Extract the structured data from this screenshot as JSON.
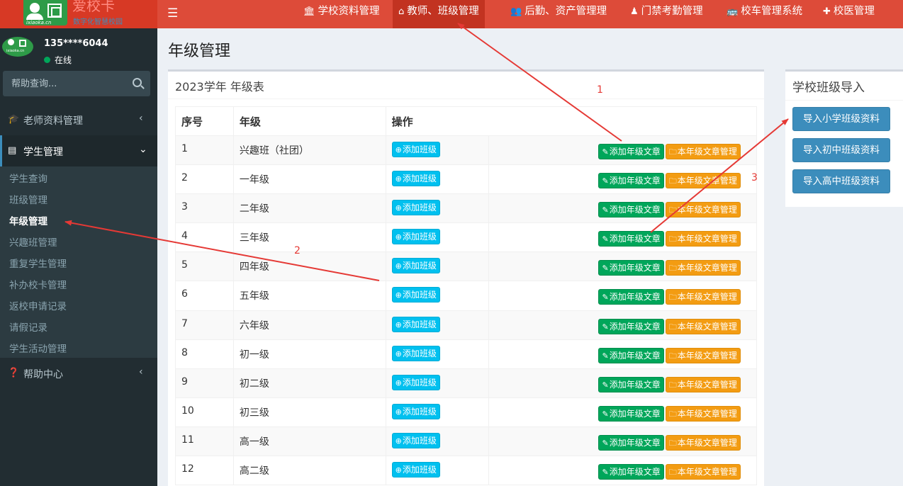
{
  "brand": {
    "logo_url_text": "ixiaoka.cn",
    "name": "爱校卡",
    "slogan": "数字化智慧校园"
  },
  "topnav": {
    "items": [
      {
        "icon": "bank-icon",
        "label": "学校资料管理"
      },
      {
        "icon": "home-icon",
        "label": "教师、班级管理"
      },
      {
        "icon": "users-icon",
        "label": "后勤、资产管理理"
      },
      {
        "icon": "person-icon",
        "label": "门禁考勤管理"
      },
      {
        "icon": "bus-icon",
        "label": "校车管理系统"
      },
      {
        "icon": "plus-icon",
        "label": "校医管理"
      }
    ]
  },
  "user": {
    "name": "135****6044",
    "status": "在线"
  },
  "search": {
    "placeholder": "帮助查询..."
  },
  "sidebar": {
    "menus": [
      {
        "icon": "graduation-cap-icon",
        "label": "老师资料管理"
      },
      {
        "icon": "id-card-icon",
        "label": "学生管理"
      },
      {
        "icon": "question-circle-icon",
        "label": "帮助中心"
      }
    ],
    "submenu": [
      "学生查询",
      "班级管理",
      "年级管理",
      "兴趣班管理",
      "重复学生管理",
      "补办校卡管理",
      "返校申请记录",
      "请假记录",
      "学生活动管理"
    ]
  },
  "page": {
    "title": "年级管理"
  },
  "grade_box": {
    "title": "2023学年 年级表",
    "headers": [
      "序号",
      "年级",
      "操作"
    ],
    "add_class_label": "添加班级",
    "add_article_label": "添加年级文章",
    "manage_article_label": "本年级文章管理",
    "rows": [
      {
        "no": "1",
        "grade": "兴趣班（社团）"
      },
      {
        "no": "2",
        "grade": "一年级"
      },
      {
        "no": "3",
        "grade": "二年级"
      },
      {
        "no": "4",
        "grade": "三年级"
      },
      {
        "no": "5",
        "grade": "四年级"
      },
      {
        "no": "6",
        "grade": "五年级"
      },
      {
        "no": "7",
        "grade": "六年级"
      },
      {
        "no": "8",
        "grade": "初一级"
      },
      {
        "no": "9",
        "grade": "初二级"
      },
      {
        "no": "10",
        "grade": "初三级"
      },
      {
        "no": "11",
        "grade": "高一级"
      },
      {
        "no": "12",
        "grade": "高二级"
      }
    ]
  },
  "import_box": {
    "title": "学校班级导入",
    "buttons": [
      "导入小学班级资料",
      "导入初中班级资料",
      "导入高中班级资料"
    ]
  },
  "annotations": {
    "labels": [
      "1",
      "2",
      "3"
    ],
    "color": "#e53935"
  },
  "colors": {
    "topbar": "#dd4b39",
    "sidebar": "#222d32",
    "btn_info": "#00c0ef",
    "btn_success": "#00a65a",
    "btn_warning": "#f39c12",
    "btn_primary": "#3c8dbc"
  }
}
